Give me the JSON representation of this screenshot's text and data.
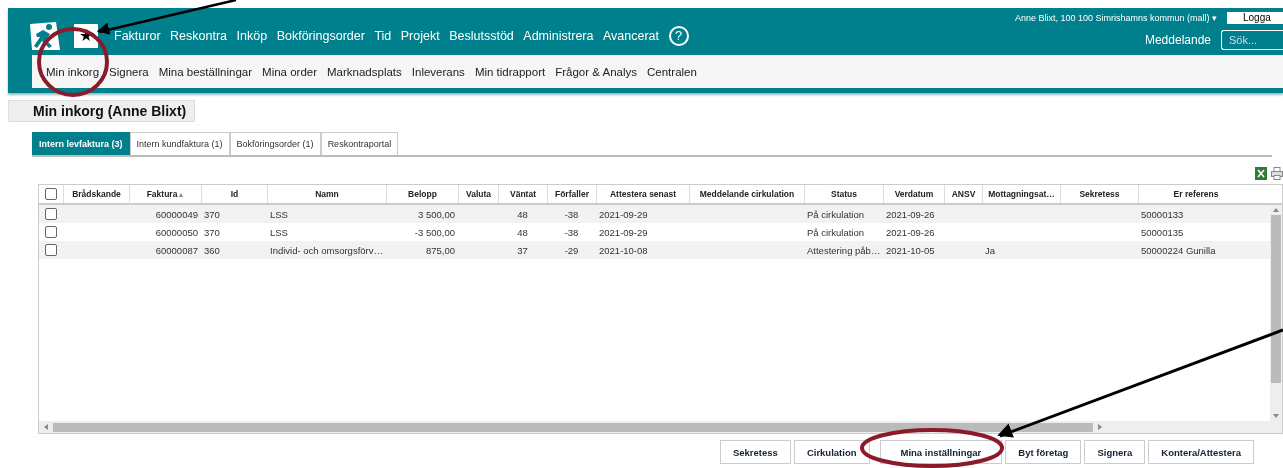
{
  "header": {
    "star": "★",
    "nav": [
      "Fakturor",
      "Reskontra",
      "Inköp",
      "Bokföringsorder",
      "Tid",
      "Projekt",
      "Beslutsstöd",
      "Administrera",
      "Avancerat"
    ],
    "help": "?",
    "user": "Anne Blixt, 100 100 Simrishamns kommun (mall)",
    "user_caret": "▾",
    "logout": "Logga",
    "messages": "Meddelande",
    "search": {
      "placeholder": "Sök..."
    }
  },
  "subnav": [
    {
      "label": "Min inkorg"
    },
    {
      "label": "Signera"
    },
    {
      "label": "Mina beställningar"
    },
    {
      "label": "Mina order"
    },
    {
      "label": "Marknadsplats"
    },
    {
      "label": "Inleverans"
    },
    {
      "label": "Min tidrapport"
    },
    {
      "label": "Frågor & Analys"
    },
    {
      "label": "Centralen"
    }
  ],
  "page_title": "Min inkorg (Anne Blixt)",
  "tabs": [
    {
      "label": "Intern levfaktura (3)",
      "selected": true
    },
    {
      "label": "Intern kundfaktura (1)",
      "selected": false
    },
    {
      "label": "Bokföringsorder (1)",
      "selected": false
    },
    {
      "label": "Reskontraportal",
      "selected": false
    }
  ],
  "table": {
    "select_all_checked": false,
    "columns": [
      {
        "label": "Brådskande"
      },
      {
        "label": "Faktura",
        "sort": "▲"
      },
      {
        "label": "Id"
      },
      {
        "label": "Namn"
      },
      {
        "label": "Belopp"
      },
      {
        "label": "Valuta"
      },
      {
        "label": "Väntat"
      },
      {
        "label": "Förfaller"
      },
      {
        "label": "Attestera senast"
      },
      {
        "label": "Meddelande cirkulation"
      },
      {
        "label": "Status"
      },
      {
        "label": "Verdatum"
      },
      {
        "label": "ANSV"
      },
      {
        "label": "Mottagningsat…"
      },
      {
        "label": "Sekretess"
      },
      {
        "label": "Er referens"
      }
    ],
    "rows": [
      {
        "checked": false,
        "cells": [
          "",
          "60000049",
          "370",
          "LSS",
          "3 500,00",
          "",
          "48",
          "-38",
          "2021-09-29",
          "",
          "På cirkulation",
          "2021-09-26",
          "",
          "",
          "",
          "50000133"
        ]
      },
      {
        "checked": false,
        "cells": [
          "",
          "60000050",
          "370",
          "LSS",
          "-3 500,00",
          "",
          "48",
          "-38",
          "2021-09-29",
          "",
          "På cirkulation",
          "2021-09-26",
          "",
          "",
          "",
          "50000135"
        ]
      },
      {
        "checked": false,
        "cells": [
          "",
          "60000087",
          "360",
          "Individ- och omsorgsförv…",
          "875,00",
          "",
          "37",
          "-29",
          "2021-10-08",
          "",
          "Attestering påb…",
          "2021-10-05",
          "",
          "Ja",
          "",
          "50000224 Gunilla"
        ]
      }
    ]
  },
  "buttons": [
    "Sekretess",
    "Cirkulation",
    "Mina inställningar",
    "Byt företag",
    "Signera",
    "Kontera/Attestera"
  ]
}
